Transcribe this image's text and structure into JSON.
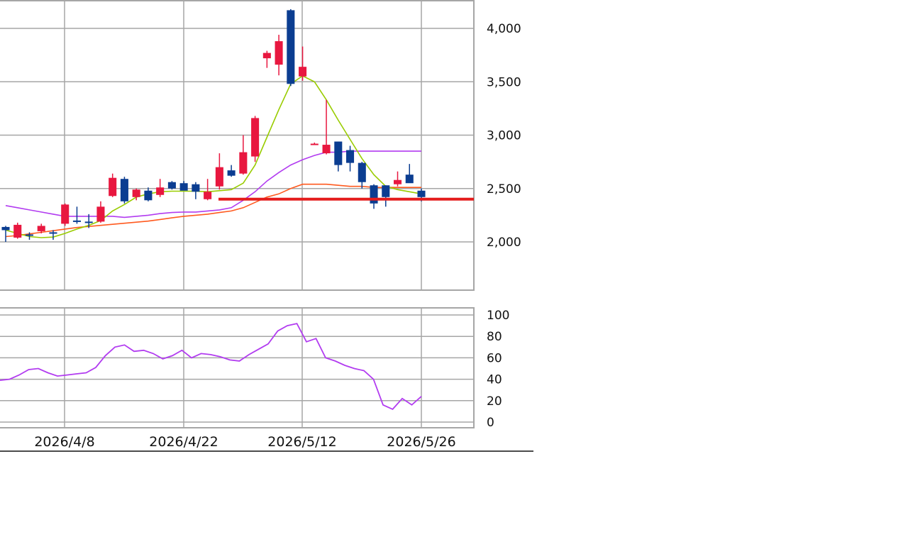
{
  "colors": {
    "grid": "#a6a6a6",
    "up_candle": "#e8173f",
    "down_candle": "#0b3d91",
    "ma_short": "#99cc00",
    "ma_mid": "#b23cf0",
    "ma_long": "#ff5a1f",
    "support_line": "#e41c1c",
    "oscillator": "#b23cf0"
  },
  "chart_data": [
    {
      "type": "candlestick",
      "ylim": [
        1560,
        4250
      ],
      "yticks": [
        2000,
        2500,
        3000,
        3500,
        4000
      ],
      "ytick_labels": [
        "2,000",
        "2,500",
        "3,000",
        "3,500",
        "4,000"
      ],
      "x_labels": [
        "2026/4/8",
        "2026/4/22",
        "2026/5/12",
        "2026/5/26"
      ],
      "grid": true,
      "candles": [
        {
          "o": 2140,
          "h": 2150,
          "l": 2000,
          "c": 2110
        },
        {
          "o": 2040,
          "h": 2180,
          "l": 2030,
          "c": 2160
        },
        {
          "o": 2070,
          "h": 2090,
          "l": 2020,
          "c": 2060
        },
        {
          "o": 2100,
          "h": 2170,
          "l": 2080,
          "c": 2150
        },
        {
          "o": 2090,
          "h": 2110,
          "l": 2020,
          "c": 2080
        },
        {
          "o": 2170,
          "h": 2360,
          "l": 2150,
          "c": 2350
        },
        {
          "o": 2200,
          "h": 2330,
          "l": 2170,
          "c": 2190
        },
        {
          "o": 2190,
          "h": 2260,
          "l": 2130,
          "c": 2180
        },
        {
          "o": 2190,
          "h": 2380,
          "l": 2180,
          "c": 2330
        },
        {
          "o": 2430,
          "h": 2640,
          "l": 2420,
          "c": 2600
        },
        {
          "o": 2590,
          "h": 2610,
          "l": 2360,
          "c": 2380
        },
        {
          "o": 2420,
          "h": 2500,
          "l": 2390,
          "c": 2490
        },
        {
          "o": 2480,
          "h": 2510,
          "l": 2380,
          "c": 2390
        },
        {
          "o": 2440,
          "h": 2590,
          "l": 2420,
          "c": 2510
        },
        {
          "o": 2560,
          "h": 2570,
          "l": 2490,
          "c": 2500
        },
        {
          "o": 2550,
          "h": 2570,
          "l": 2490,
          "c": 2480
        },
        {
          "o": 2540,
          "h": 2560,
          "l": 2400,
          "c": 2470
        },
        {
          "o": 2400,
          "h": 2590,
          "l": 2390,
          "c": 2470
        },
        {
          "o": 2520,
          "h": 2830,
          "l": 2490,
          "c": 2700
        },
        {
          "o": 2670,
          "h": 2720,
          "l": 2610,
          "c": 2620
        },
        {
          "o": 2640,
          "h": 3000,
          "l": 2630,
          "c": 2840
        },
        {
          "o": 2800,
          "h": 3180,
          "l": 2750,
          "c": 3160
        },
        {
          "o": 3720,
          "h": 3790,
          "l": 3630,
          "c": 3770
        },
        {
          "o": 3660,
          "h": 3940,
          "l": 3560,
          "c": 3880
        },
        {
          "o": 4170,
          "h": 4180,
          "l": 3460,
          "c": 3480
        },
        {
          "o": 3550,
          "h": 3830,
          "l": 3510,
          "c": 3640
        },
        {
          "o": 2920,
          "h": 2930,
          "l": 2910,
          "c": 2920
        },
        {
          "o": 2830,
          "h": 3330,
          "l": 2820,
          "c": 2910
        },
        {
          "o": 2940,
          "h": 2940,
          "l": 2660,
          "c": 2720
        },
        {
          "o": 2860,
          "h": 2900,
          "l": 2660,
          "c": 2740
        },
        {
          "o": 2740,
          "h": 2750,
          "l": 2500,
          "c": 2560
        },
        {
          "o": 2530,
          "h": 2540,
          "l": 2310,
          "c": 2360
        },
        {
          "o": 2530,
          "h": 2530,
          "l": 2330,
          "c": 2420
        },
        {
          "o": 2540,
          "h": 2660,
          "l": 2520,
          "c": 2580
        },
        {
          "o": 2630,
          "h": 2730,
          "l": 2560,
          "c": 2550
        },
        {
          "o": 2480,
          "h": 2500,
          "l": 2380,
          "c": 2420
        }
      ],
      "ma_short": [
        2110,
        2080,
        2050,
        2040,
        2045,
        2080,
        2120,
        2155,
        2200,
        2290,
        2350,
        2420,
        2450,
        2470,
        2475,
        2475,
        2475,
        2470,
        2480,
        2490,
        2550,
        2720,
        2980,
        3240,
        3480,
        3555,
        3500,
        3330,
        3140,
        2960,
        2780,
        2630,
        2520,
        2490,
        2470,
        2450
      ],
      "ma_mid": [
        2340,
        2320,
        2300,
        2280,
        2260,
        2240,
        2240,
        2240,
        2240,
        2240,
        2230,
        2240,
        2250,
        2265,
        2275,
        2280,
        2280,
        2290,
        2300,
        2320,
        2390,
        2470,
        2570,
        2650,
        2720,
        2770,
        2810,
        2840,
        2840,
        2850,
        2850,
        2850,
        2850,
        2850,
        2850,
        2850
      ],
      "ma_long": [
        2050,
        2060,
        2075,
        2090,
        2105,
        2120,
        2135,
        2145,
        2155,
        2165,
        2175,
        2185,
        2195,
        2210,
        2225,
        2240,
        2250,
        2260,
        2275,
        2290,
        2320,
        2370,
        2420,
        2450,
        2500,
        2540,
        2540,
        2540,
        2530,
        2520,
        2520,
        2510,
        2510,
        2510,
        2510,
        2510
      ],
      "support_level": 2400
    },
    {
      "type": "line",
      "ylim": [
        0,
        100
      ],
      "yticks": [
        0,
        20,
        40,
        60,
        80,
        100
      ],
      "ytick_labels": [
        "0",
        "20",
        "40",
        "60",
        "80",
        "100"
      ],
      "grid": true,
      "values": [
        39,
        40,
        44,
        49,
        50,
        46,
        43,
        44,
        45,
        46,
        51,
        62,
        70,
        72,
        66,
        67,
        64,
        59,
        62,
        67,
        60,
        64,
        63,
        61,
        58,
        57,
        63,
        68,
        73,
        85,
        90,
        92,
        75,
        78,
        60,
        57,
        53,
        50,
        48,
        40,
        16,
        12,
        22,
        16,
        24
      ]
    }
  ]
}
